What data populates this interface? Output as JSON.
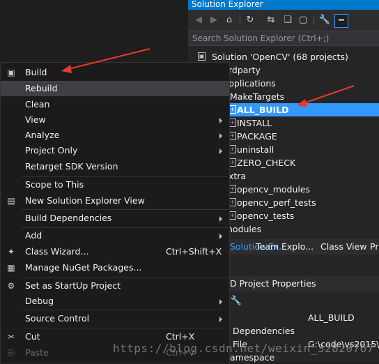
{
  "solution_explorer": {
    "title": "Solution Explorer",
    "search_placeholder": "Search Solution Explorer (Ctrl+;)",
    "tree": [
      {
        "label": "Solution 'OpenCV' (68 projects)",
        "icon": "solution-icon"
      },
      {
        "label": "rdparty",
        "icon": "folder-icon"
      },
      {
        "label": "pplications",
        "icon": "folder-icon"
      },
      {
        "label": "MakeTargets",
        "icon": "folder-icon"
      },
      {
        "label": "ALL_BUILD",
        "icon": "cpp-project-icon",
        "selected": true
      },
      {
        "label": "INSTALL",
        "icon": "cpp-project-icon"
      },
      {
        "label": "PACKAGE",
        "icon": "cpp-project-icon"
      },
      {
        "label": "uninstall",
        "icon": "cpp-project-icon"
      },
      {
        "label": "ZERO_CHECK",
        "icon": "cpp-project-icon"
      },
      {
        "label": "xtra",
        "icon": "folder-icon"
      },
      {
        "label": "opencv_modules",
        "icon": "cpp-project-icon"
      },
      {
        "label": "opencv_perf_tests",
        "icon": "cpp-project-icon"
      },
      {
        "label": "opencv_tests",
        "icon": "cpp-project-icon"
      },
      {
        "label": "nodules",
        "icon": "folder-icon"
      }
    ],
    "tabs": [
      "Solution Ex...",
      "Team Explo...",
      "Class View",
      "Pr"
    ],
    "properties": {
      "title": "D Project Properties",
      "rows": [
        {
          "key": "",
          "value": "ALL_BUILD"
        },
        {
          "key": "Dependencies",
          "value": ""
        },
        {
          "key": "File",
          "value": "G:\\code\\vs2015\\"
        },
        {
          "key": "amespace",
          "value": ""
        }
      ]
    }
  },
  "context_menu": {
    "items": [
      {
        "label": "Build",
        "icon": "build-icon",
        "shortcut": "",
        "submenu": false
      },
      {
        "label": "Rebuild",
        "icon": "",
        "shortcut": "",
        "submenu": false,
        "highlighted": true
      },
      {
        "label": "Clean",
        "icon": "",
        "shortcut": "",
        "submenu": false
      },
      {
        "label": "View",
        "icon": "",
        "shortcut": "",
        "submenu": true
      },
      {
        "label": "Analyze",
        "icon": "",
        "shortcut": "",
        "submenu": true
      },
      {
        "label": "Project Only",
        "icon": "",
        "shortcut": "",
        "submenu": true
      },
      {
        "label": "Retarget SDK Version",
        "icon": "",
        "shortcut": "",
        "submenu": false
      },
      {
        "label": "Scope to This",
        "icon": "",
        "shortcut": "",
        "submenu": false
      },
      {
        "label": "New Solution Explorer View",
        "icon": "new-view-icon",
        "shortcut": "",
        "submenu": false
      },
      {
        "label": "Build Dependencies",
        "icon": "",
        "shortcut": "",
        "submenu": true
      },
      {
        "label": "Add",
        "icon": "",
        "shortcut": "",
        "submenu": true
      },
      {
        "label": "Class Wizard...",
        "icon": "class-wizard-icon",
        "shortcut": "Ctrl+Shift+X",
        "submenu": false
      },
      {
        "label": "Manage NuGet Packages...",
        "icon": "nuget-icon",
        "shortcut": "",
        "submenu": false
      },
      {
        "label": "Set as StartUp Project",
        "icon": "gear-icon",
        "shortcut": "",
        "submenu": false
      },
      {
        "label": "Debug",
        "icon": "",
        "shortcut": "",
        "submenu": true
      },
      {
        "label": "Source Control",
        "icon": "",
        "shortcut": "",
        "submenu": true
      },
      {
        "label": "Cut",
        "icon": "scissors-icon",
        "shortcut": "Ctrl+X",
        "submenu": false
      },
      {
        "label": "Paste",
        "icon": "paste-icon",
        "shortcut": "Ctrl+V",
        "submenu": false,
        "disabled": true
      }
    ]
  },
  "watermark": "https://blog.csdn.net/weixin_32820767",
  "colors": {
    "accent": "#007acc",
    "selection": "#3399ff",
    "annotation_arrow": "#e8392d",
    "menu_bg": "#1b1b1c",
    "pane_bg": "#252526"
  }
}
